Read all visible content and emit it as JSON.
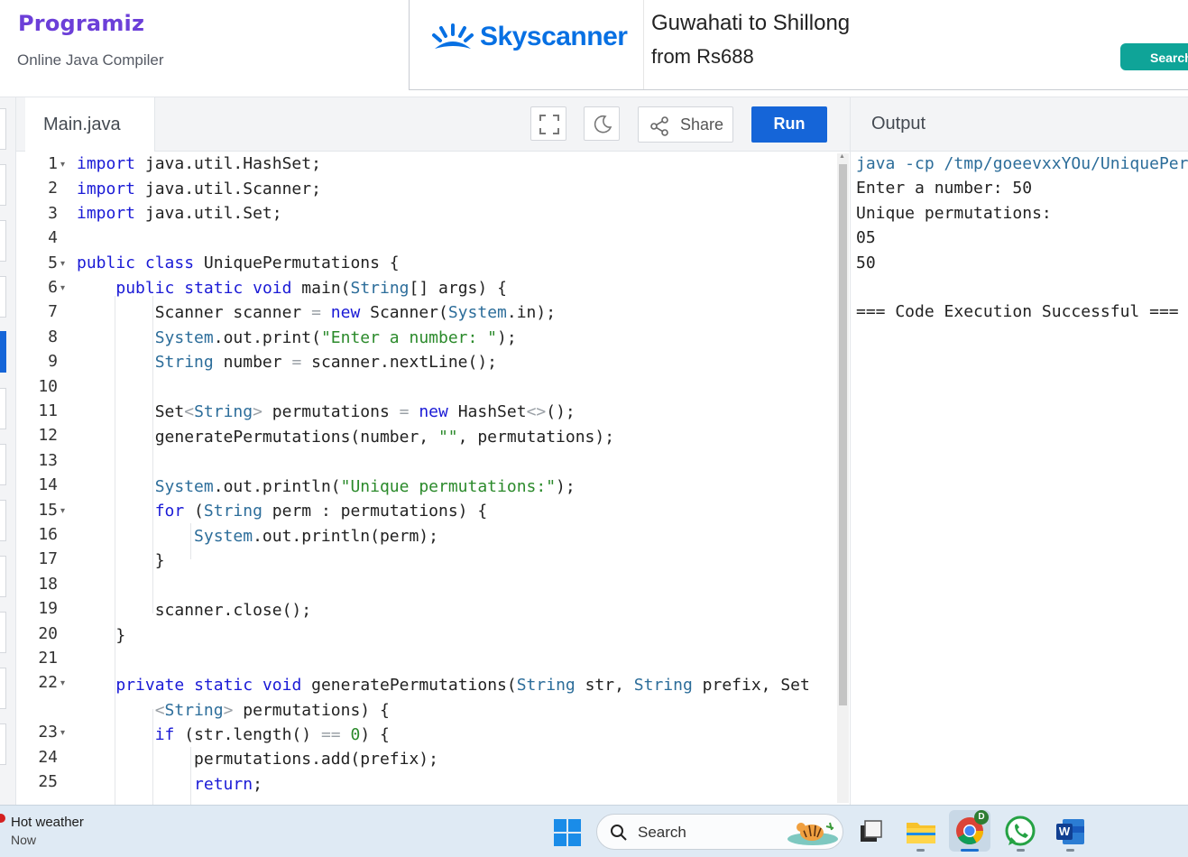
{
  "header": {
    "logo_text": "Programiz",
    "subtitle": "Online Java Compiler"
  },
  "ad": {
    "brand": "Skyscanner",
    "route": "Guwahati to Shillong",
    "price": "from Rs688",
    "button": "Search"
  },
  "toolbar": {
    "tab_label": "Main.java",
    "fullscreen_icon": "fullscreen-icon",
    "theme_icon": "moon-icon",
    "share_label": "Share",
    "run_label": "Run"
  },
  "editor": {
    "line_numbers": [
      "1",
      "2",
      "3",
      "4",
      "5",
      "6",
      "7",
      "8",
      "9",
      "10",
      "11",
      "12",
      "13",
      "14",
      "15",
      "16",
      "17",
      "18",
      "19",
      "20",
      "21",
      "22",
      "",
      "23",
      "24",
      "25"
    ],
    "foldable_lines": [
      "1",
      "5",
      "6",
      "15",
      "22",
      "23"
    ]
  },
  "output": {
    "title": "Output",
    "lines": [
      "java -cp /tmp/goeevxxYOu/UniquePerm",
      "Enter a number: 50",
      "Unique permutations:",
      "05",
      "50",
      "",
      "=== Code Execution Successful ==="
    ]
  },
  "taskbar": {
    "weather_title": "Hot weather",
    "weather_time": "Now",
    "search_label": "Search",
    "chrome_badge": "D",
    "word_letter": "W"
  }
}
